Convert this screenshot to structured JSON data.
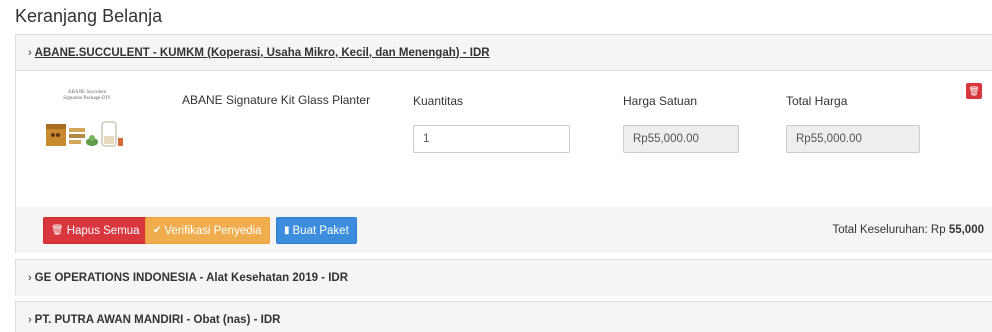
{
  "page": {
    "title": "Keranjang Belanja"
  },
  "vendors": [
    {
      "heading": "ABANE.SUCCULENT - KUMKM (Koperasi, Usaha Mikro, Kecil, dan Menengah) - IDR",
      "item": {
        "image_caption_line1": "ABANE Succulent",
        "image_caption_line2": "Signature Package-DIY",
        "name": "ABANE Signature Kit Glass Planter",
        "qty_label": "Kuantitas",
        "qty_value": "1",
        "unit_price_label": "Harga Satuan",
        "unit_price_value": "Rp55,000.00",
        "total_label": "Total Harga",
        "total_value": "Rp55,000.00",
        "delete_icon": "trash-icon"
      },
      "footer": {
        "delete_all_label": "Hapus Semua",
        "verify_label": "Verifikasi Penyedia",
        "create_package_label": "Buat Paket",
        "grand_total_label": "Total Keseluruhan: Rp",
        "grand_total_value": "55,000"
      }
    },
    {
      "heading": "GE OPERATIONS INDONESIA - Alat Kesehatan 2019 - IDR"
    },
    {
      "heading": "PT. PUTRA AWAN MANDIRI - Obat (nas) - IDR"
    }
  ],
  "icons": {
    "chevron": "chevron-right-icon",
    "trash": "trash-icon",
    "check": "check-icon",
    "file": "file-icon"
  },
  "colors": {
    "danger": "#d9363e",
    "warning": "#f0ad4e",
    "primary": "#3c8dde",
    "panel_bg": "#f5f5f5"
  }
}
